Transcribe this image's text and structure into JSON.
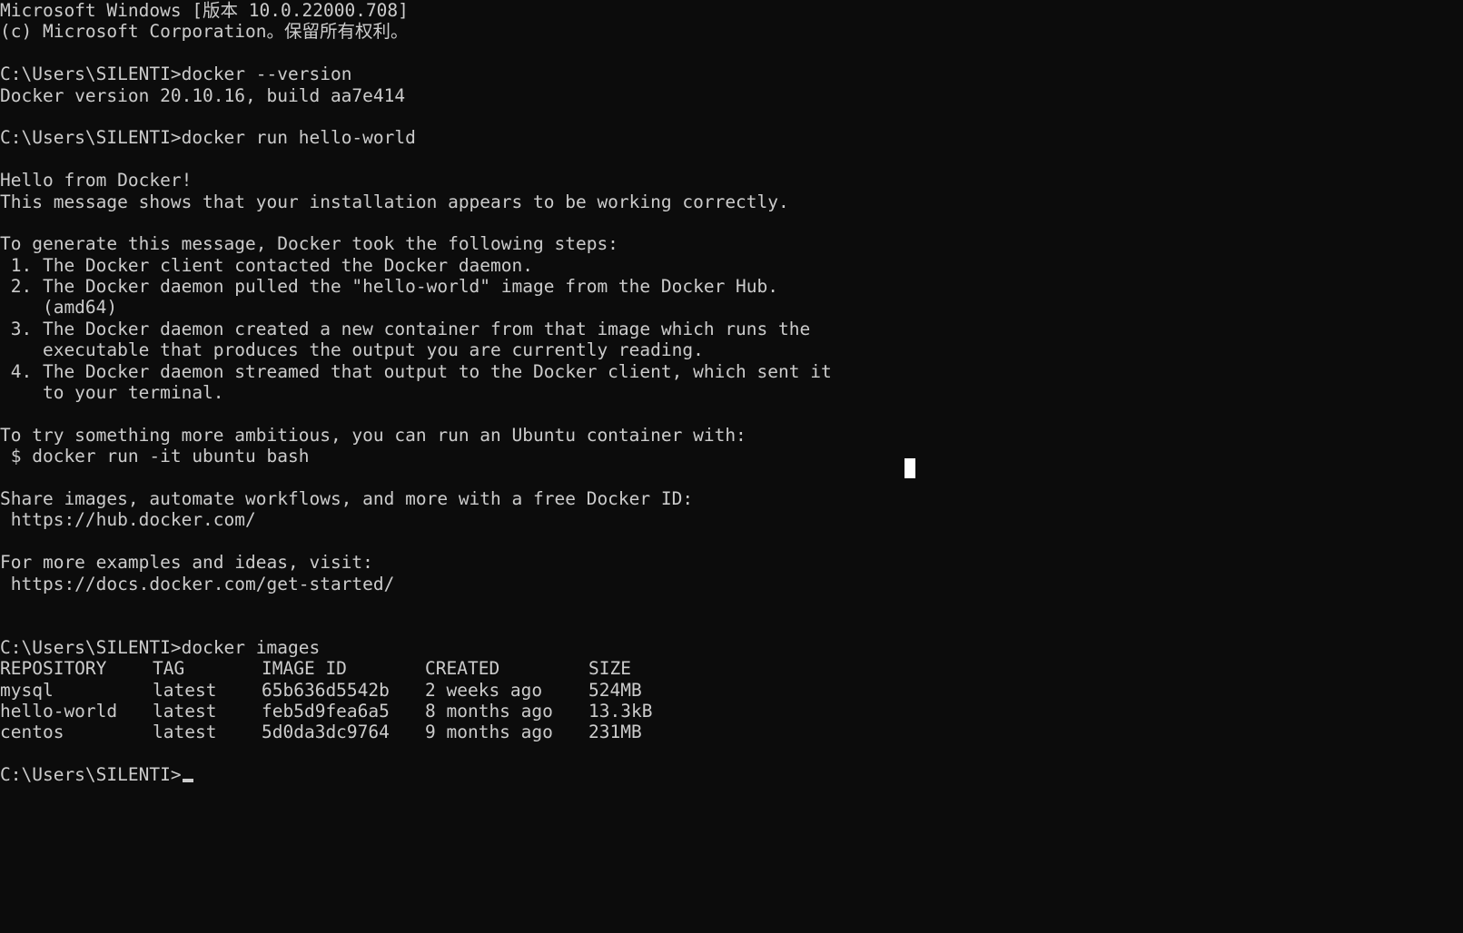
{
  "header": {
    "line1": "Microsoft Windows [版本 10.0.22000.708]",
    "line2": "(c) Microsoft Corporation。保留所有权利。"
  },
  "session": {
    "prompt": "C:\\Users\\SILENTI>",
    "cmd_version": "docker --version",
    "out_version": "Docker version 20.10.16, build aa7e414",
    "cmd_run": "docker run hello-world",
    "hello": [
      "Hello from Docker!",
      "This message shows that your installation appears to be working correctly.",
      "To generate this message, Docker took the following steps:",
      " 1. The Docker client contacted the Docker daemon.",
      " 2. The Docker daemon pulled the \"hello-world\" image from the Docker Hub.",
      "    (amd64)",
      " 3. The Docker daemon created a new container from that image which runs the",
      "    executable that produces the output you are currently reading.",
      " 4. The Docker daemon streamed that output to the Docker client, which sent it",
      "    to your terminal.",
      "To try something more ambitious, you can run an Ubuntu container with:",
      " $ docker run -it ubuntu bash",
      "Share images, automate workflows, and more with a free Docker ID:",
      " https://hub.docker.com/",
      "For more examples and ideas, visit:",
      " https://docs.docker.com/get-started/"
    ],
    "cmd_images": "docker images"
  },
  "images_table": {
    "headers": [
      "REPOSITORY",
      "TAG",
      "IMAGE ID",
      "CREATED",
      "SIZE"
    ],
    "rows": [
      [
        "mysql",
        "latest",
        "65b636d5542b",
        "2 weeks ago",
        "524MB"
      ],
      [
        "hello-world",
        "latest",
        "feb5d9fea6a5",
        "8 months ago",
        "13.3kB"
      ],
      [
        "centos",
        "latest",
        "5d0da3dc9764",
        "9 months ago",
        "231MB"
      ]
    ]
  },
  "colors": {
    "background": "#0c0c0c",
    "foreground": "#cccccc"
  }
}
